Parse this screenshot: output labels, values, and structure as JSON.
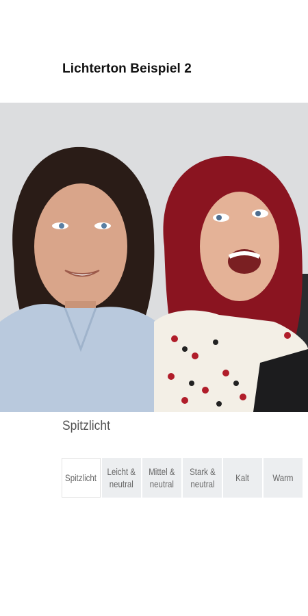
{
  "page": {
    "title": "Lichterton Beispiel 2"
  },
  "image": {
    "alt": "Zwei Frauen auf einem Sofa"
  },
  "selection": {
    "caption": "Spitzlicht"
  },
  "options": [
    {
      "label": "Spitzlicht",
      "active": true
    },
    {
      "label": "Leicht &\nneutral",
      "active": false
    },
    {
      "label": "Mittel &\nneutral",
      "active": false
    },
    {
      "label": "Stark &\nneutral",
      "active": false
    },
    {
      "label": "Kalt",
      "active": false
    },
    {
      "label": "Warm",
      "active": false
    }
  ],
  "colors": {
    "background": "#ffffff",
    "option_bg": "#eceef0",
    "text": "#111111",
    "muted": "#555555"
  }
}
